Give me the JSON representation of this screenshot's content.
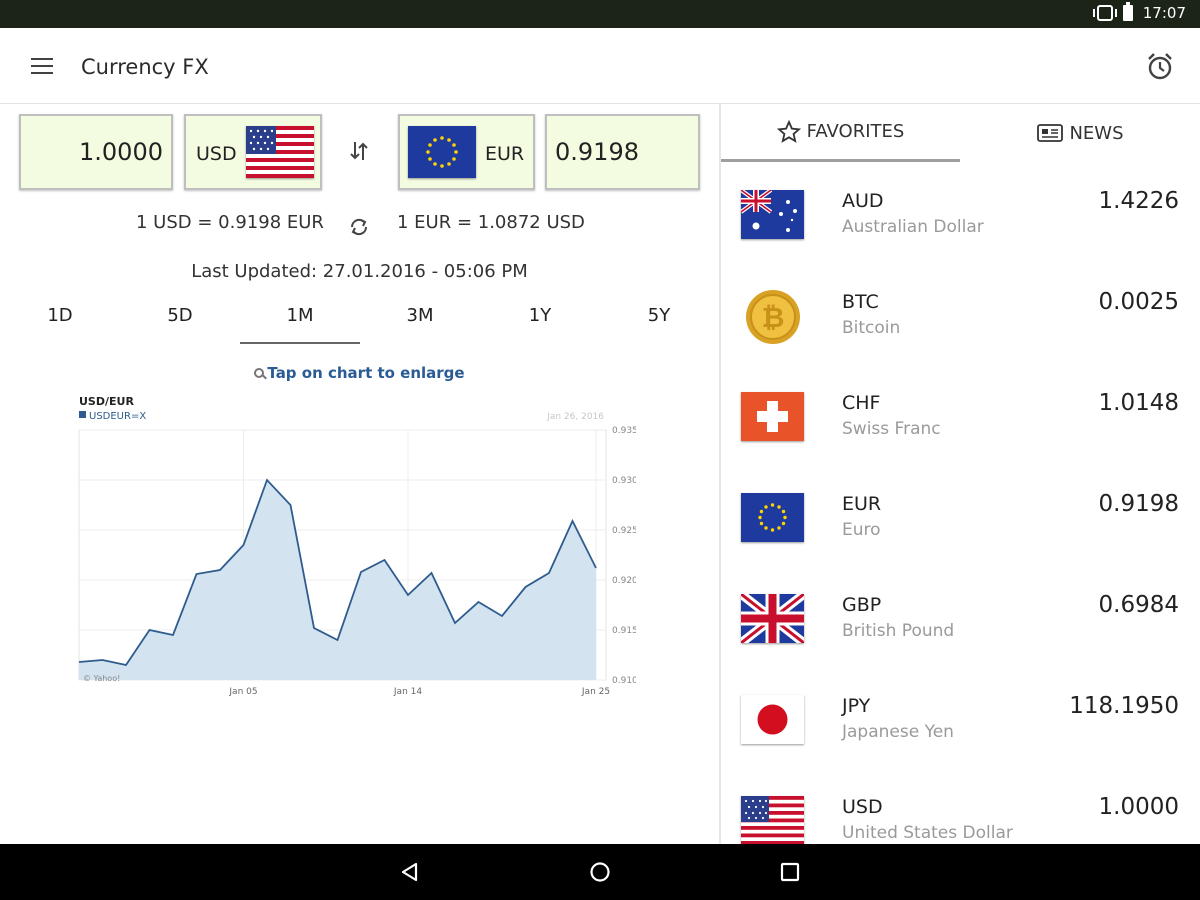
{
  "status_bar": {
    "time": "17:07"
  },
  "app": {
    "title": "Currency FX"
  },
  "converter": {
    "from_amount": "1.0000",
    "from_currency": "USD",
    "to_currency": "EUR",
    "to_amount": "0.9198",
    "rate_forward": "1 USD = 0.9198 EUR",
    "rate_reverse": "1 EUR = 1.0872 USD",
    "last_updated": "Last Updated: 27.01.2016 - 05:06 PM"
  },
  "range_tabs": [
    "1D",
    "5D",
    "1M",
    "3M",
    "1Y",
    "5Y"
  ],
  "range_selected": "1M",
  "chart_hint": "Tap on chart to enlarge",
  "chart_data": {
    "type": "area",
    "title": "USD/EUR",
    "series_label": "USDEUR=X",
    "date_label": "Jan 26, 2016",
    "watermark": "© Yahoo!",
    "x_tick_labels": [
      "Jan 05",
      "Jan 14",
      "Jan 25"
    ],
    "y_tick_labels": [
      "0.935",
      "0.930",
      "0.925",
      "0.920",
      "0.915",
      "0.910"
    ],
    "ylim": [
      0.91,
      0.935
    ],
    "series": [
      {
        "name": "USDEUR=X",
        "values": [
          0.9118,
          0.912,
          0.9115,
          0.915,
          0.9145,
          0.9206,
          0.921,
          0.9235,
          0.93,
          0.9275,
          0.9152,
          0.914,
          0.9208,
          0.922,
          0.9185,
          0.9207,
          0.9157,
          0.9178,
          0.9164,
          0.9193,
          0.9207,
          0.9259,
          0.9212
        ]
      }
    ],
    "color": "#2e5c8e",
    "fill": "#d3e3f0",
    "grid": true
  },
  "right_tabs": {
    "favorites": "FAVORITES",
    "news": "NEWS"
  },
  "favorites": [
    {
      "code": "AUD",
      "name": "Australian Dollar",
      "value": "1.4226",
      "flag": "australia-flag"
    },
    {
      "code": "BTC",
      "name": "Bitcoin",
      "value": "0.0025",
      "flag": "bitcoin-icon"
    },
    {
      "code": "CHF",
      "name": "Swiss Franc",
      "value": "1.0148",
      "flag": "swiss-flag"
    },
    {
      "code": "EUR",
      "name": "Euro",
      "value": "0.9198",
      "flag": "eu-flag"
    },
    {
      "code": "GBP",
      "name": "British Pound",
      "value": "0.6984",
      "flag": "uk-flag"
    },
    {
      "code": "JPY",
      "name": "Japanese Yen",
      "value": "118.1950",
      "flag": "japan-flag"
    },
    {
      "code": "USD",
      "name": "United States Dollar",
      "value": "1.0000",
      "flag": "us-flag"
    }
  ],
  "colors": {
    "status_bar": "#1b2417",
    "input_bg": "#f3fbe1",
    "hint": "#2a5b95",
    "nav_bar": "#000000"
  }
}
